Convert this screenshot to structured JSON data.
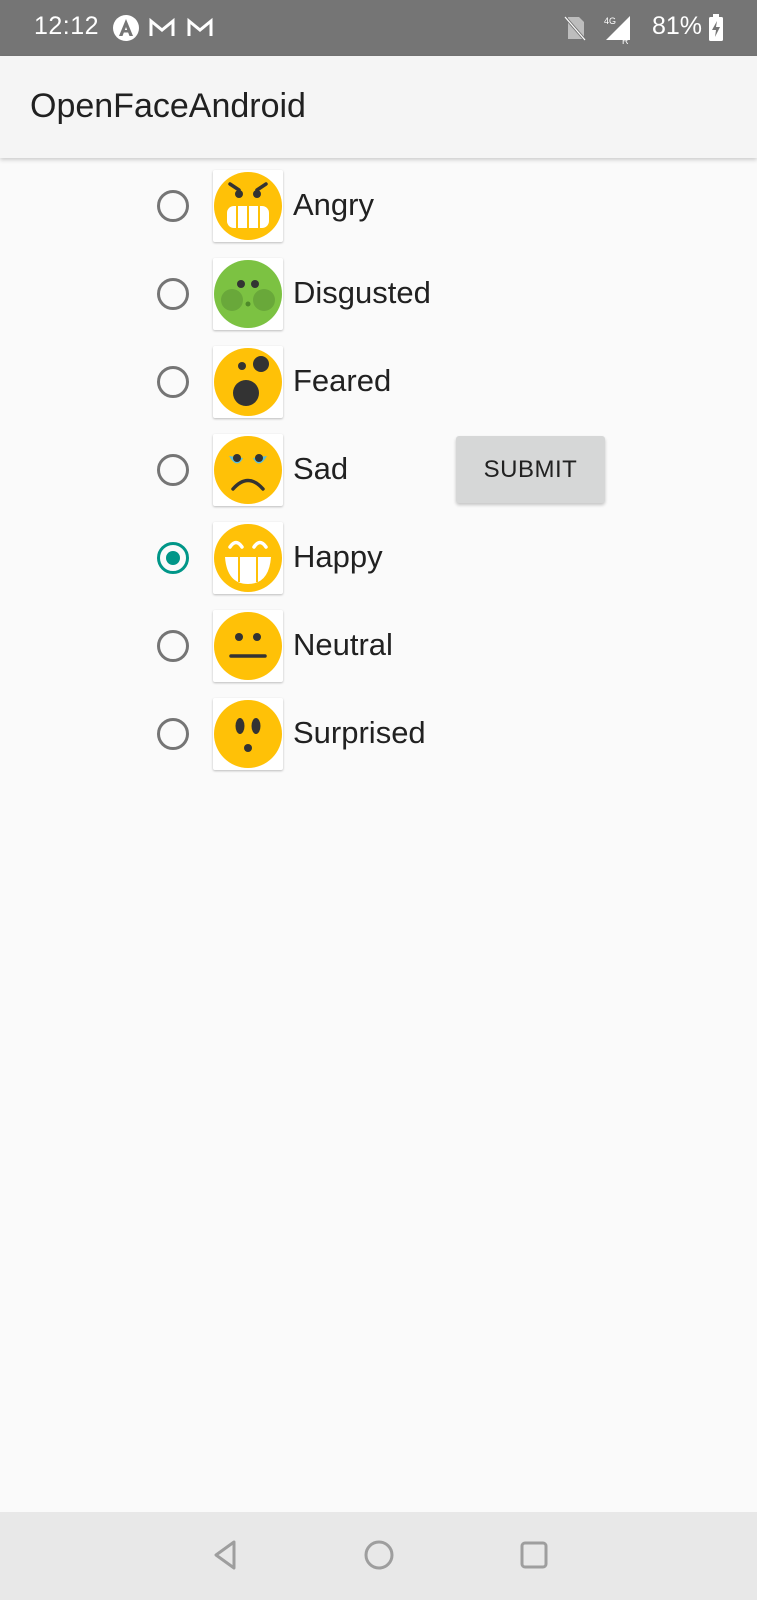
{
  "status_bar": {
    "time": "12:12",
    "network": "4G",
    "roaming": "R",
    "battery": "81%"
  },
  "app_bar": {
    "title": "OpenFaceAndroid"
  },
  "emotions": [
    {
      "label": "Angry",
      "icon": "angry-face-icon",
      "checked": false
    },
    {
      "label": "Disgusted",
      "icon": "disgusted-face-icon",
      "checked": false
    },
    {
      "label": "Feared",
      "icon": "fearful-face-icon",
      "checked": false
    },
    {
      "label": "Sad",
      "icon": "sad-face-icon",
      "checked": false
    },
    {
      "label": "Happy",
      "icon": "happy-face-icon",
      "checked": true
    },
    {
      "label": "Neutral",
      "icon": "neutral-face-icon",
      "checked": false
    },
    {
      "label": "Surprised",
      "icon": "surprised-face-icon",
      "checked": false
    }
  ],
  "submit_label": "SUBMIT",
  "colors": {
    "accent": "#009688",
    "emoji_yellow": "#ffc107",
    "emoji_green": "#7cc242"
  }
}
